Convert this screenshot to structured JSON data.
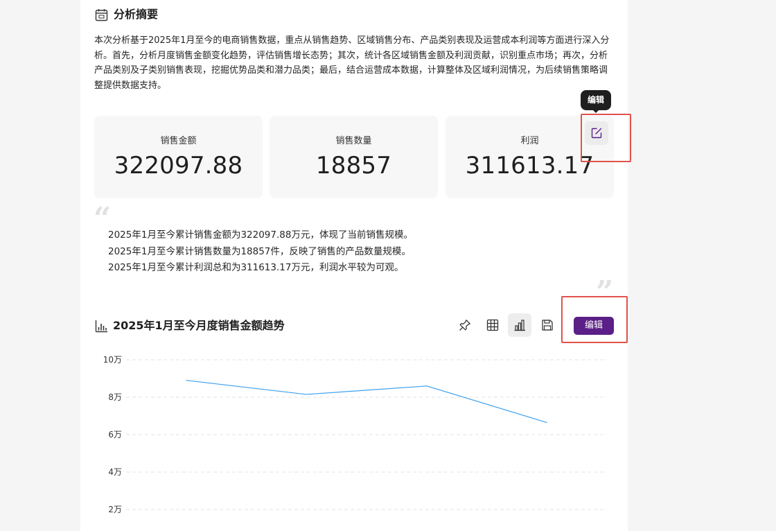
{
  "summary": {
    "title": "分析摘要",
    "text": "本次分析基于2025年1月至今的电商销售数据，重点从销售趋势、区域销售分布、产品类别表现及运营成本利润等方面进行深入分析。首先，分析月度销售金额变化趋势，评估销售增长态势；其次，统计各区域销售金额及利润贡献，识别重点市场；再次，分析产品类别及子类别销售表现，挖掘优势品类和潜力品类；最后，结合运营成本数据，计算整体及区域利润情况，为后续销售策略调整提供数据支持。"
  },
  "kpis": [
    {
      "label": "销售金额",
      "value": "322097.88"
    },
    {
      "label": "销售数量",
      "value": "18857"
    },
    {
      "label": "利润",
      "value": "311613.17"
    }
  ],
  "tooltip": {
    "text": "编辑"
  },
  "insights": [
    "2025年1月至今累计销售金额为322097.88万元，体现了当前销售规模。",
    "2025年1月至今累计销售数量为18857件，反映了销售的产品数量规模。",
    "2025年1月至今累计利润总和为311613.17万元，利润水平较为可观。"
  ],
  "chart_section": {
    "title": "2025年1月至今月度销售金额趋势",
    "edit_label": "编辑",
    "toolbar_icons": [
      "pin-icon",
      "table-icon",
      "bar-chart-icon",
      "save-icon"
    ]
  },
  "icons": {
    "summary": "calendar-icon",
    "chart": "bar-chart-icon",
    "kpi_edit": "edit-icon"
  },
  "colors": {
    "accent": "#5b1f87",
    "line": "#3a9ff0",
    "highlight": "#e0524b"
  },
  "chart_data": {
    "type": "line",
    "x": [
      "",
      "",
      "",
      ""
    ],
    "series": [
      {
        "values": [
          89000,
          81500,
          86000,
          66500
        ]
      }
    ],
    "yticks": [
      "10万",
      "8万",
      "6万",
      "4万",
      "2万"
    ],
    "ytick_values": [
      100000,
      80000,
      60000,
      40000,
      20000
    ],
    "ylim": [
      20000,
      100000
    ],
    "grid": true
  }
}
